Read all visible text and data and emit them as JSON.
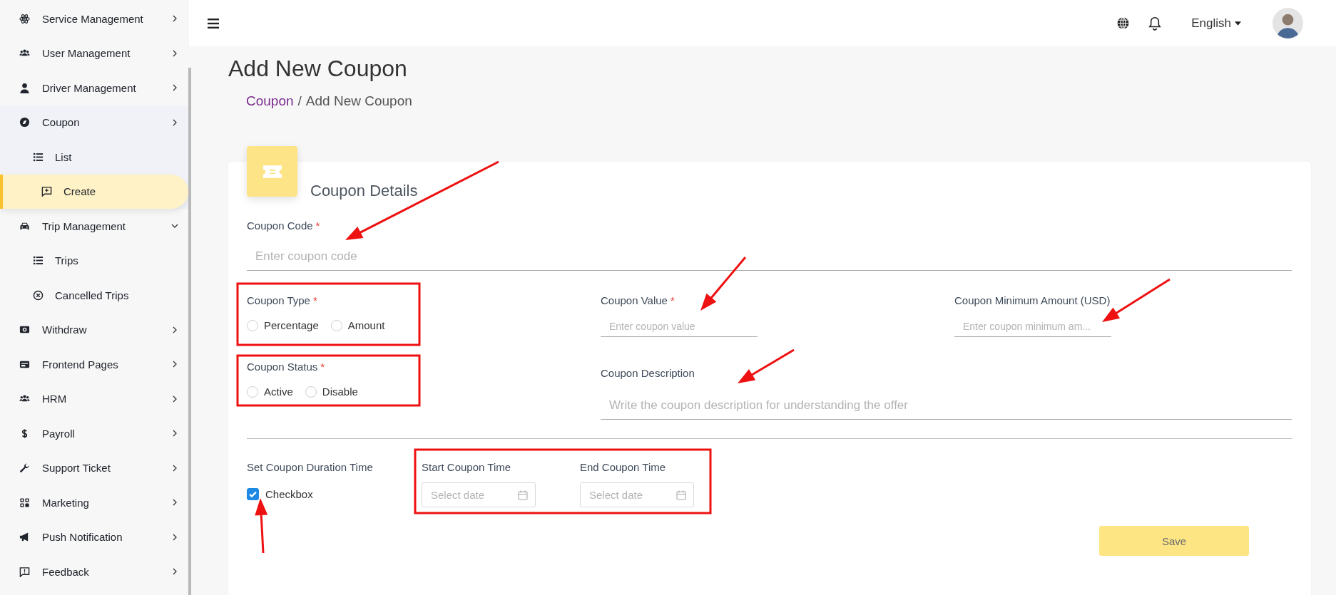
{
  "sidebar": {
    "items": [
      {
        "label": "Service Management",
        "expanded": false,
        "selected": false
      },
      {
        "label": "User Management",
        "expanded": false,
        "selected": false
      },
      {
        "label": "Driver Management",
        "expanded": false,
        "selected": false
      },
      {
        "label": "Coupon",
        "expanded": false,
        "selected": false,
        "children": [
          {
            "label": "List",
            "selected": false
          },
          {
            "label": "Create",
            "selected": true
          }
        ]
      },
      {
        "label": "Trip Management",
        "expanded": true,
        "selected": false,
        "children": [
          {
            "label": "Trips",
            "selected": false
          },
          {
            "label": "Cancelled Trips",
            "selected": false
          }
        ]
      },
      {
        "label": "Withdraw",
        "expanded": false,
        "selected": false
      },
      {
        "label": "Frontend Pages",
        "expanded": false,
        "selected": false
      },
      {
        "label": "HRM",
        "expanded": false,
        "selected": false
      },
      {
        "label": "Payroll",
        "expanded": false,
        "selected": false
      },
      {
        "label": "Support Ticket",
        "expanded": false,
        "selected": false
      },
      {
        "label": "Marketing",
        "expanded": false,
        "selected": false
      },
      {
        "label": "Push Notification",
        "expanded": false,
        "selected": false
      },
      {
        "label": "Feedback",
        "expanded": false,
        "selected": false
      }
    ]
  },
  "header": {
    "language": "English"
  },
  "page": {
    "title": "Add New Coupon",
    "breadcrumb": {
      "link": "Coupon",
      "separator": "/",
      "current": "Add New Coupon"
    }
  },
  "form": {
    "title": "Coupon Details",
    "code": {
      "label": "Coupon Code",
      "marker": "*",
      "placeholder": "Enter coupon code"
    },
    "type": {
      "label": "Coupon Type",
      "marker": "*",
      "options": [
        {
          "label": "Percentage",
          "selected": false
        },
        {
          "label": "Amount",
          "selected": false
        }
      ]
    },
    "value": {
      "label": "Coupon Value",
      "marker": "*",
      "placeholder": "Enter coupon value"
    },
    "minimum": {
      "label": "Coupon Minimum Amount (USD)",
      "placeholder": "Enter coupon minimum am..."
    },
    "status": {
      "label": "Coupon Status",
      "marker": "*",
      "options": [
        {
          "label": "Active",
          "selected": false
        },
        {
          "label": "Disable",
          "selected": false
        }
      ]
    },
    "description": {
      "label": "Coupon Description",
      "placeholder": "Write the coupon description for understanding the offer"
    },
    "duration": {
      "label": "Set Coupon Duration Time",
      "checkbox": {
        "label": "Checkbox",
        "checked": true
      },
      "start": {
        "label": "Start Coupon Time",
        "placeholder": "Select date"
      },
      "end": {
        "label": "End Coupon Time",
        "placeholder": "Select date"
      }
    },
    "save": "Save"
  }
}
